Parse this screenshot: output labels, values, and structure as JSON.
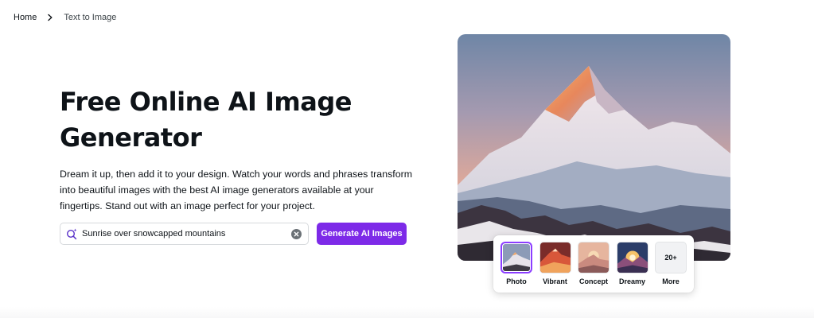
{
  "breadcrumb": {
    "home": "Home",
    "current": "Text to Image"
  },
  "hero": {
    "title": "Free Online AI Image Generator",
    "description": "Dream it up, then add it to your design. Watch your words and phrases transform into beautiful images with the best AI image generators available at your fingertips. Stand out with an image perfect for your project."
  },
  "prompt": {
    "value": "Sunrise over snowcapped mountains",
    "icon": "magic-search-icon",
    "clear_icon": "clear-icon"
  },
  "generate_button": {
    "label": "Generate AI Images"
  },
  "styles": [
    {
      "label": "Photo",
      "selected": true
    },
    {
      "label": "Vibrant",
      "selected": false
    },
    {
      "label": "Concept",
      "selected": false
    },
    {
      "label": "Dreamy",
      "selected": false
    },
    {
      "label": "More",
      "badge": "20+",
      "selected": false
    }
  ],
  "colors": {
    "accent": "#7d2ae8",
    "selected_outline": "#8b3dff",
    "text": "#0e1318"
  }
}
